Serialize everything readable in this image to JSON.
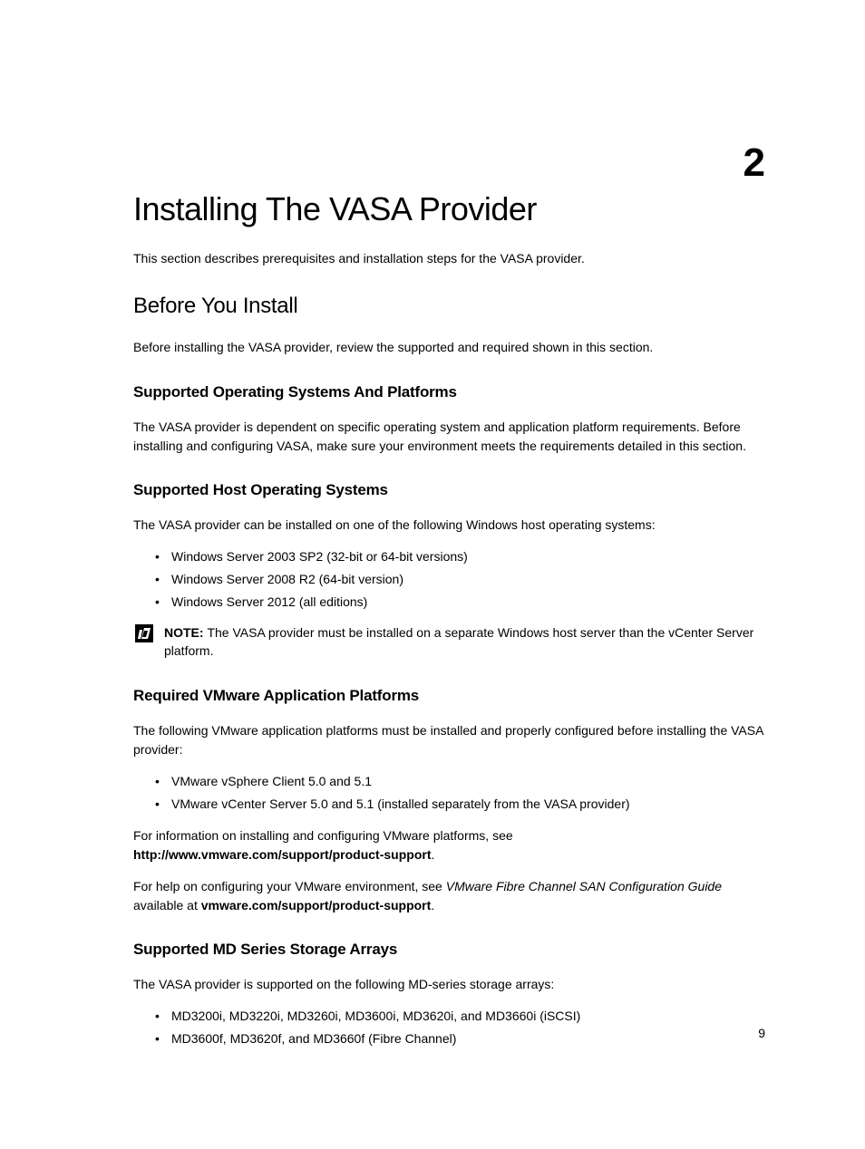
{
  "chapter": {
    "number": "2",
    "title": "Installing The VASA Provider",
    "intro": "This section describes prerequisites and installation steps for the VASA provider."
  },
  "before_install": {
    "heading": "Before You Install",
    "text": "Before installing the VASA provider, review the supported and required shown in this section."
  },
  "supported_os_platforms": {
    "heading": "Supported Operating Systems And Platforms",
    "text": "The VASA provider is dependent on specific operating system and application platform requirements. Before installing and configuring VASA, make sure your environment meets the requirements detailed in this section."
  },
  "supported_host_os": {
    "heading": "Supported Host Operating Systems",
    "intro": "The VASA provider can be installed on one of the following Windows host operating systems:",
    "items": [
      "Windows Server 2003 SP2 (32-bit or 64-bit versions)",
      "Windows Server 2008 R2 (64-bit version)",
      "Windows Server 2012 (all editions)"
    ],
    "note_label": "NOTE: ",
    "note_text": "The VASA provider must be installed on a separate Windows host server than the vCenter Server platform."
  },
  "required_vmware": {
    "heading": "Required VMware Application Platforms",
    "intro": "The following VMware application platforms must be installed and properly configured before installing the VASA provider:",
    "items": [
      "VMware vSphere Client 5.0 and 5.1",
      "VMware vCenter Server 5.0 and 5.1 (installed separately from the VASA provider)"
    ],
    "info1_pre": "For information on installing and configuring VMware platforms, see ",
    "info1_link": "http://www.vmware.com/support/product-support",
    "info1_post": ".",
    "info2_pre": "For help on configuring your VMware environment, see ",
    "info2_doc": "VMware Fibre Channel SAN Configuration Guide",
    "info2_mid": " available at ",
    "info2_link": "vmware.com/support/product-support",
    "info2_post": "."
  },
  "supported_md": {
    "heading": "Supported MD Series Storage Arrays",
    "intro": "The VASA provider is supported on the following MD-series storage arrays:",
    "items": [
      "MD3200i, MD3220i, MD3260i, MD3600i, MD3620i, and MD3660i (iSCSI)",
      "MD3600f, MD3620f, and MD3660f (Fibre Channel)"
    ]
  },
  "page_number": "9"
}
